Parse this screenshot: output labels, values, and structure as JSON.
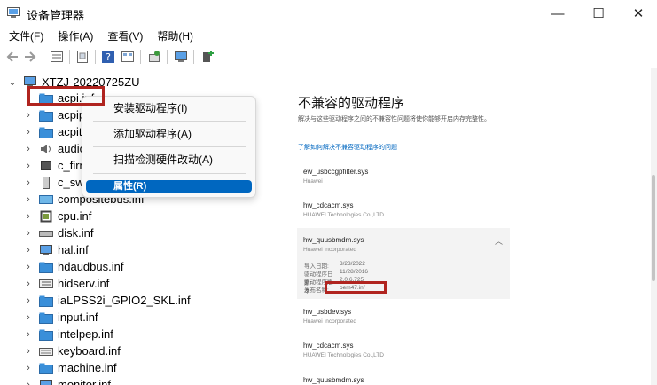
{
  "window": {
    "title": "设备管理器",
    "minimize_glyph": "—",
    "maximize_glyph": "☐",
    "close_glyph": "✕"
  },
  "menubar": {
    "items": [
      "文件(F)",
      "操作(A)",
      "查看(V)",
      "帮助(H)"
    ]
  },
  "toolbar": {
    "buttons": [
      "back-arrow-icon",
      "forward-arrow-icon",
      "properties-icon",
      "driver-sheet-icon",
      "help-icon",
      "view-icon",
      "scan-icon",
      "monitor-icon",
      "add-driver-icon"
    ]
  },
  "tree": {
    "root": "XTZJ-20220725ZU",
    "items": [
      {
        "label": "acpi.inf",
        "icon": "folder-icon"
      },
      {
        "label": "acpip",
        "icon": "folder-icon"
      },
      {
        "label": "acpiti",
        "icon": "folder-icon"
      },
      {
        "label": "audio",
        "icon": "speaker-icon"
      },
      {
        "label": "c_firm",
        "icon": "chip-icon"
      },
      {
        "label": "c_swd",
        "icon": "device-icon"
      },
      {
        "label": "compositebus.inf",
        "icon": "bus-icon"
      },
      {
        "label": "cpu.inf",
        "icon": "cpu-icon"
      },
      {
        "label": "disk.inf",
        "icon": "disk-icon"
      },
      {
        "label": "hal.inf",
        "icon": "monitor-icon"
      },
      {
        "label": "hdaudbus.inf",
        "icon": "folder-icon"
      },
      {
        "label": "hidserv.inf",
        "icon": "hid-icon"
      },
      {
        "label": "iaLPSS2i_GPIO2_SKL.inf",
        "icon": "folder-icon"
      },
      {
        "label": "input.inf",
        "icon": "folder-icon"
      },
      {
        "label": "intelpep.inf",
        "icon": "folder-icon"
      },
      {
        "label": "keyboard.inf",
        "icon": "keyboard-icon"
      },
      {
        "label": "machine.inf",
        "icon": "folder-icon"
      },
      {
        "label": "monitor.inf",
        "icon": "monitor-icon"
      }
    ]
  },
  "context_menu": {
    "items": [
      "安装驱动程序(I)",
      "添加驱动程序(A)",
      "扫描检测硬件改动(A)",
      "属性(R)"
    ],
    "hovered": "属性(R)"
  },
  "panel": {
    "title": "不兼容的驱动程序",
    "description": "解决与这些驱动程序之间的不兼容性问题将使你能够开启内存完整性。",
    "link": "了解如何解决不兼容驱动程序的问题",
    "drivers": [
      {
        "name": "ew_usbccgpfilter.sys",
        "manufacturer": "Huawei"
      },
      {
        "name": "hw_cdcacm.sys",
        "manufacturer": "HUAWEI Technologies Co.,LTD"
      },
      {
        "name": "hw_quusbmdm.sys",
        "manufacturer": "Huawei Incorporated"
      },
      {
        "name": "hw_usbdev.sys",
        "manufacturer": "Huawei Incorporated"
      },
      {
        "name": "hw_cdcacm.sys",
        "manufacturer": "HUAWEI Technologies Co.,LTD"
      },
      {
        "name": "hw_quusbmdm.sys",
        "manufacturer": ""
      }
    ],
    "expanded_details": {
      "import_date_label": "导入日期:",
      "import_date": "3/23/2022",
      "driver_date_label": "驱动程序日期:",
      "driver_date": "11/28/2016",
      "driver_version_label": "驱动程序版本:",
      "driver_version": "2.0.6.725",
      "published_name_label": "发布名称:",
      "published_name": "oem47.inf"
    }
  },
  "colors": {
    "highlight_box": "#b0241f",
    "accent": "#0067c0",
    "folder": "#f5c542"
  }
}
